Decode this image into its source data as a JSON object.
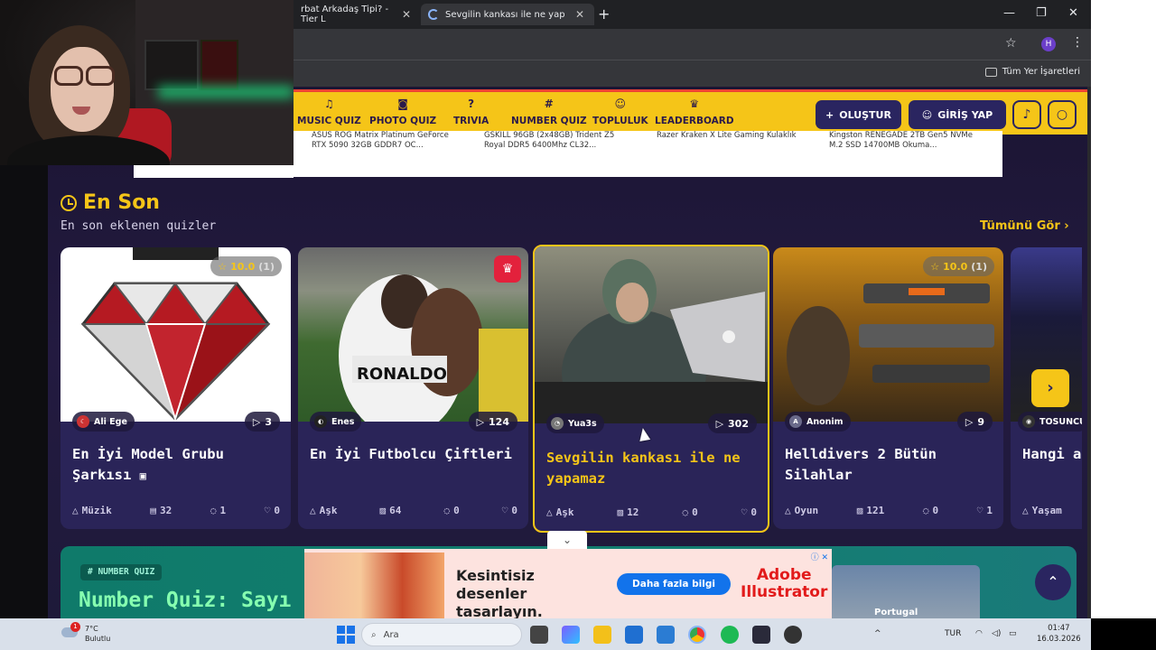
{
  "browser": {
    "tabs": [
      {
        "title": "rbat Arkadaş Tipi? - Tier L"
      },
      {
        "title": "Sevgilin kankası ile ne yapamaz"
      }
    ],
    "all_bookmarks": "Tüm Yer İşaretleri",
    "profile_initial": "H"
  },
  "site_nav": {
    "items": [
      {
        "label": "MUSIC QUIZ",
        "icon": "music-icon"
      },
      {
        "label": "PHOTO QUIZ",
        "icon": "camera-icon"
      },
      {
        "label": "TRIVIA",
        "icon": "question-icon"
      },
      {
        "label": "NUMBER QUIZ",
        "icon": "hash-icon"
      },
      {
        "label": "TOPLULUK",
        "icon": "users-icon"
      },
      {
        "label": "LEADERBOARD",
        "icon": "trophy-icon"
      }
    ],
    "create_label": "OLUŞTUR",
    "login_label": "GİRİŞ YAP"
  },
  "products": [
    {
      "line1": "ASUS ROG Matrix Platinum GeForce",
      "line2": "RTX 5090 32GB GDDR7 OC..."
    },
    {
      "line1": "GSKILL 96GB (2x48GB) Trident Z5",
      "line2": "Royal DDR5 6400Mhz CL32..."
    },
    {
      "line1": "Razer Kraken X Lite Gaming Kulaklık",
      "line2": ""
    },
    {
      "line1": "Kingston RENEGADE 2TB Gen5 NVMe",
      "line2": "M.2 SSD 14700MB Okuma..."
    }
  ],
  "section": {
    "title": "En Son",
    "subtitle": "En son eklenen quizler",
    "see_all": "Tümünü Gör"
  },
  "cards": [
    {
      "author": "Ali Ege",
      "plays": "3",
      "title": "En İyi Model Grubu Şarkısı",
      "category": "Müzik",
      "items": "32",
      "comments": "1",
      "likes": "0",
      "rating": "10.0",
      "rating_count": "(1)"
    },
    {
      "author": "Enes",
      "plays": "124",
      "title": "En İyi Futbolcu Çiftleri",
      "category": "Aşk",
      "items": "64",
      "comments": "0",
      "likes": "0"
    },
    {
      "author": "Yua3s",
      "plays": "302",
      "title": "Sevgilin kankası ile ne yapamaz",
      "category": "Aşk",
      "items": "12",
      "comments": "0",
      "likes": "0"
    },
    {
      "author": "Anonim",
      "author_initial": "A",
      "plays": "9",
      "title": "Helldivers 2 Bütün Silahlar",
      "category": "Oyun",
      "items": "121",
      "comments": "0",
      "likes": "1",
      "rating": "10.0",
      "rating_count": "(1)"
    },
    {
      "author": "TOSUNCU",
      "title": "Hangi a edersin",
      "category": "Yaşam"
    }
  ],
  "number_quiz": {
    "badge": "NUMBER QUIZ",
    "title": "Number Quiz: Sayı"
  },
  "ad": {
    "headline": "Kesintisiz desenler tasarlayın.",
    "cta": "Daha fazla bilgi",
    "brand_line1": "Adobe",
    "brand_line2": "Illustrator"
  },
  "side_promo": {
    "label": "Portugal"
  },
  "taskbar": {
    "weather_temp": "7°C",
    "weather_desc": "Bulutlu",
    "notif_count": "1",
    "search_placeholder": "Ara",
    "lang": "TUR",
    "time": "01:47",
    "date": "16.03.2026"
  },
  "colors": {
    "accent": "#f5c518",
    "nav_dark": "#2a2560",
    "card_bg": "#2a2458",
    "teal": "#0f7a6a"
  }
}
